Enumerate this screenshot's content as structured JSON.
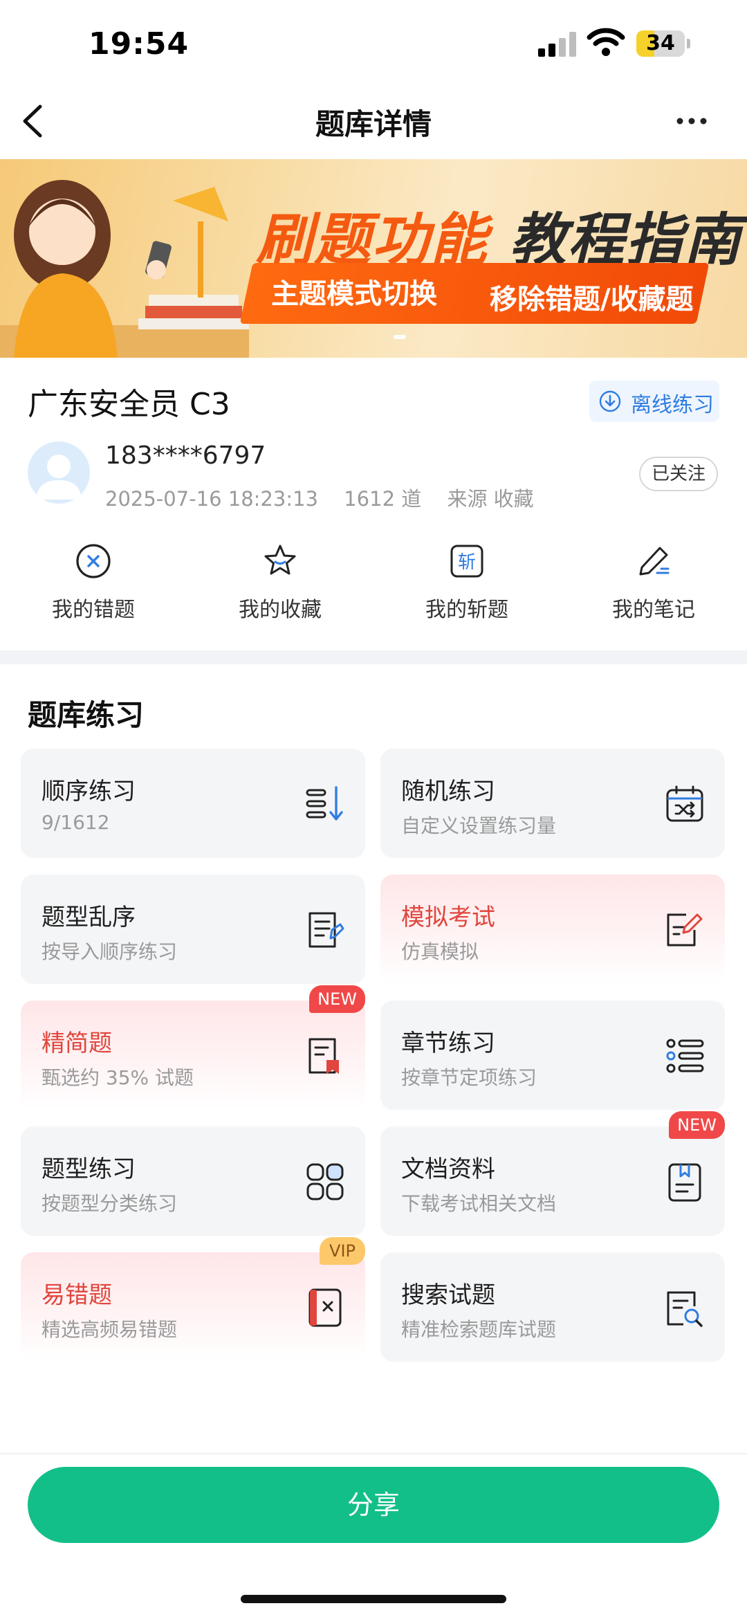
{
  "status_bar": {
    "time": "19:54",
    "battery": "34"
  },
  "nav": {
    "title": "题库详情",
    "back_icon": "chevron-left-icon",
    "more_icon": "more-dots-icon"
  },
  "banner": {
    "title_part1": "刷题",
    "title_part2": "功能",
    "title_part3": "教程指南",
    "subtitle_left": "主题模式切换",
    "subtitle_right": "移除错题/收藏题"
  },
  "bank": {
    "title": "广东安全员 C3",
    "offline_label": "离线练习",
    "user_name": "183****6797",
    "date": "2025-07-16 18:23:13",
    "count": "1612 道",
    "source": "来源 收藏",
    "follow_label": "已关注"
  },
  "quick_actions": [
    {
      "label": "我的错题",
      "icon": "x-circle-icon"
    },
    {
      "label": "我的收藏",
      "icon": "star-icon"
    },
    {
      "label": "我的斩题",
      "icon": "slash-badge-icon",
      "glyph": "斩"
    },
    {
      "label": "我的笔记",
      "icon": "pencil-icon"
    }
  ],
  "practice": {
    "title": "题库练习",
    "cards": [
      {
        "title": "顺序练习",
        "sub": "9/1612",
        "icon": "sort-list-icon"
      },
      {
        "title": "随机练习",
        "sub": "自定义设置练习量",
        "icon": "calendar-shuffle-icon"
      },
      {
        "title": "题型乱序",
        "sub": "按导入顺序练习",
        "icon": "doc-list-icon"
      },
      {
        "title": "模拟考试",
        "sub": "仿真模拟",
        "icon": "edit-doc-icon"
      },
      {
        "title": "精简题",
        "sub": "甄选约 35% 试题",
        "icon": "doc-bookmark-icon",
        "badge": "NEW"
      },
      {
        "title": "章节练习",
        "sub": "按章节定项练习",
        "icon": "list-bullets-icon"
      },
      {
        "title": "题型练习",
        "sub": "按题型分类练习",
        "icon": "grid-apps-icon"
      },
      {
        "title": "文档资料",
        "sub": "下载考试相关文档",
        "icon": "document-icon",
        "badge": "NEW"
      },
      {
        "title": "易错题",
        "sub": "精选高频易错题",
        "icon": "error-book-icon",
        "badge": "VIP"
      },
      {
        "title": "搜索试题",
        "sub": "精准检索题库试题",
        "icon": "doc-search-icon"
      }
    ]
  },
  "share_label": "分享",
  "colors": {
    "accent_green": "#12bf88",
    "accent_red": "#e0463d",
    "link_blue": "#2f7de1"
  }
}
